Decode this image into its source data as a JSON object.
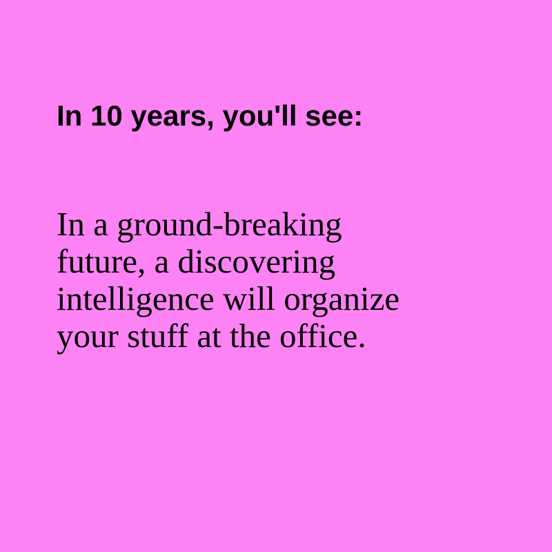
{
  "colors": {
    "background": "#fd83f5",
    "text": "#000000"
  },
  "heading": "In 10 years, you'll see:",
  "body_lines": [
    "In a ground-breaking",
    "future, a discovering",
    "intelligence will organize",
    "your stuff at the office."
  ]
}
